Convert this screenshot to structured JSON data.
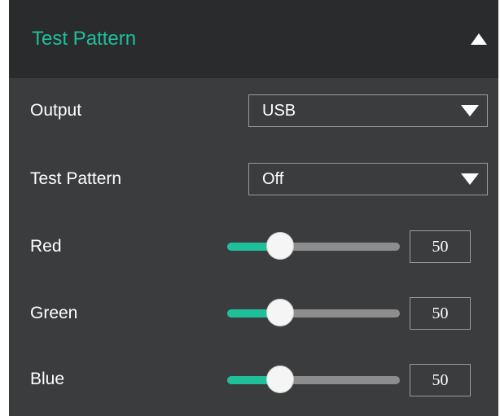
{
  "header": {
    "title": "Test Pattern",
    "collapse_icon": "triangle-up-icon"
  },
  "output": {
    "label": "Output",
    "value": "USB",
    "arrow_icon": "triangle-down-icon"
  },
  "test_pattern": {
    "label": "Test Pattern",
    "value": "Off",
    "arrow_icon": "triangle-down-icon"
  },
  "sliders": [
    {
      "label": "Red",
      "value": "50",
      "fraction": 0.25
    },
    {
      "label": "Green",
      "value": "50",
      "fraction": 0.25
    },
    {
      "label": "Blue",
      "value": "50",
      "fraction": 0.25
    }
  ],
  "colors": {
    "accent": "#1fbf9a",
    "panel_bg": "#3b3c3e",
    "header_bg": "#2a2b2d",
    "track": "#8d8d8d"
  }
}
